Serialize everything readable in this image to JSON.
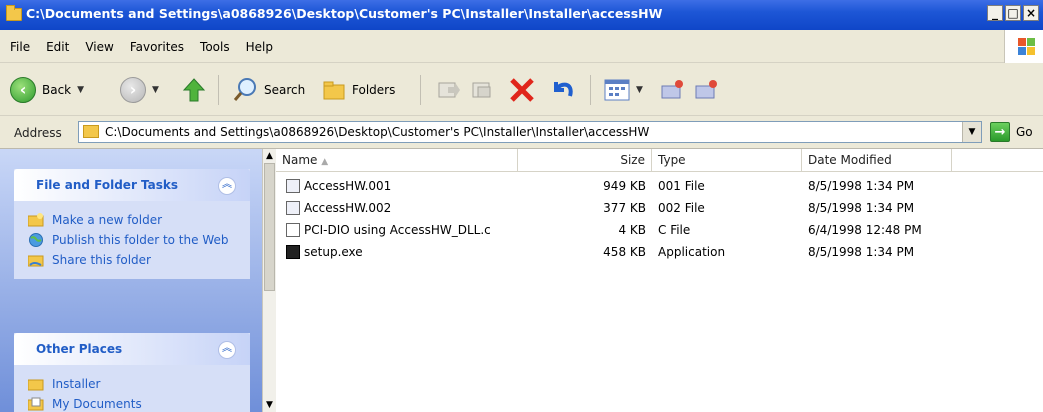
{
  "window": {
    "title": "C:\\Documents and Settings\\a0868926\\Desktop\\Customer's PC\\Installer\\Installer\\accessHW",
    "minimize": "_",
    "maximize": "□",
    "close": "×"
  },
  "menu": [
    "File",
    "Edit",
    "View",
    "Favorites",
    "Tools",
    "Help"
  ],
  "toolbar": {
    "back_label": "Back",
    "search_label": "Search",
    "folders_label": "Folders"
  },
  "address": {
    "label": "Address",
    "value": "C:\\Documents and Settings\\a0868926\\Desktop\\Customer's PC\\Installer\\Installer\\accessHW",
    "go_label": "Go"
  },
  "taskpane": {
    "file_folder_tasks": {
      "title": "File and Folder Tasks",
      "items": [
        "Make a new folder",
        "Publish this folder to the Web",
        "Share this folder"
      ]
    },
    "other_places": {
      "title": "Other Places",
      "items": [
        "Installer",
        "My Documents"
      ]
    }
  },
  "list": {
    "columns": [
      "Name",
      "Size",
      "Type",
      "Date Modified"
    ],
    "rows": [
      {
        "name": "AccessHW.001",
        "size": "949 KB",
        "type": "001 File",
        "date": "8/5/1998 1:34 PM"
      },
      {
        "name": "AccessHW.002",
        "size": "377 KB",
        "type": "002 File",
        "date": "8/5/1998 1:34 PM"
      },
      {
        "name": "PCI-DIO using AccessHW_DLL.c",
        "size": "4 KB",
        "type": "C File",
        "date": "6/4/1998 12:48 PM"
      },
      {
        "name": "setup.exe",
        "size": "458 KB",
        "type": "Application",
        "date": "8/5/1998 1:34 PM"
      }
    ]
  },
  "colors": {
    "titlebar": "#1d56d6",
    "chrome": "#ece9d8",
    "task_link": "#215dc6",
    "pane_gradient_bottom": "#6f8fd9"
  }
}
